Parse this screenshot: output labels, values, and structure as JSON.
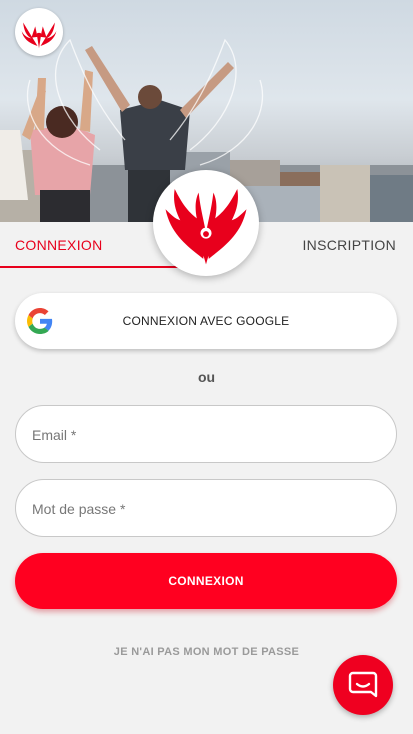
{
  "tabs": {
    "login": "CONNEXION",
    "signup": "INSCRIPTION"
  },
  "google": {
    "label": "CONNEXION AVEC GOOGLE",
    "icon": "google-icon"
  },
  "separator": "ou",
  "form": {
    "email_placeholder": "Email *",
    "password_placeholder": "Mot de passe *",
    "submit_label": "CONNEXION",
    "forgot_label": "JE N'AI PAS MON MOT DE PASSE"
  },
  "icons": {
    "logo": "phoenix-logo-icon",
    "chat": "chat-icon"
  },
  "colors": {
    "accent": "#e8001c",
    "button": "#ff0020",
    "background": "#f2f2f2"
  }
}
